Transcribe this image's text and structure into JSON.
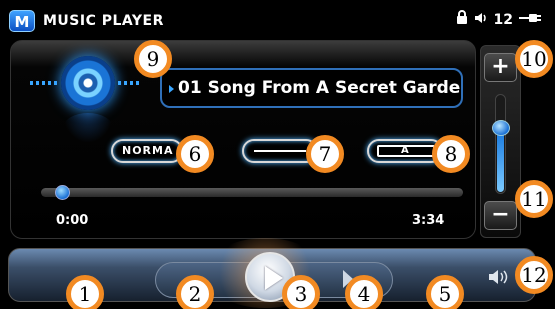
{
  "app": {
    "logo_letter": "M",
    "title": "MUSIC PLAYER"
  },
  "status_bar": {
    "lock_icon": "lock-icon",
    "volume_icon": "speaker-icon",
    "volume_value": "12",
    "power_icon": "plug-icon"
  },
  "now_playing": {
    "song_title": "01 Song From A Secret Garde",
    "disc_icon": "cd-disc-icon"
  },
  "mode_buttons": [
    {
      "label": "NORMA"
    },
    {
      "label": ""
    },
    {
      "label": "A"
    }
  ],
  "progress": {
    "elapsed": "0:00",
    "total": "3:34",
    "fraction": 0.02
  },
  "volume": {
    "plus": "+",
    "minus": "−",
    "level": 0.62
  },
  "callouts": [
    "1",
    "2",
    "3",
    "4",
    "5",
    "6",
    "7",
    "8",
    "9",
    "10",
    "11",
    "12"
  ],
  "colors": {
    "accent": "#2d9bff",
    "callout_border": "#f28a22",
    "panel_bg": "#000000"
  }
}
